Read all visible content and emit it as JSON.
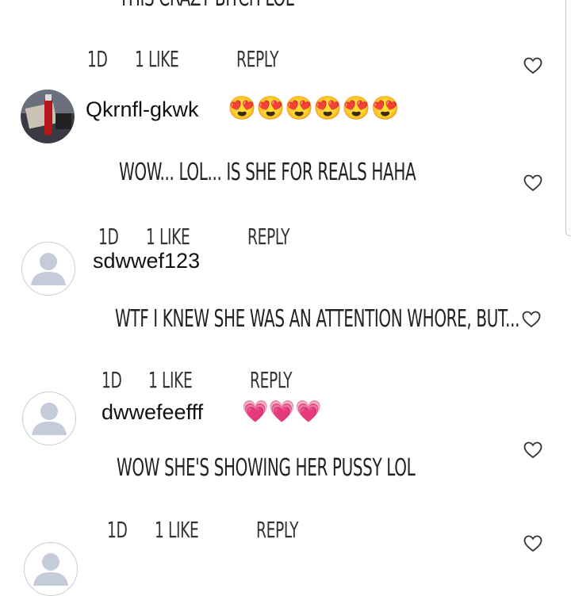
{
  "comments": [
    {
      "text": "THIS CRAZY BITCH LOL",
      "age": "1D",
      "likes": "1 LIKE",
      "reply": "REPLY"
    },
    {
      "username": "Qkrnfl-gkwk",
      "emoji": "😍😍😍😍😍😍",
      "text": "WOW... LOL... IS SHE FOR REALS HAHA",
      "age": "1D",
      "likes": "1 LIKE",
      "reply": "REPLY"
    },
    {
      "username": "sdwwef123",
      "text": "WTF I KNEW SHE WAS AN ATTENTION WHORE, BUT...",
      "age": "1D",
      "likes": "1 LIKE",
      "reply": "REPLY"
    },
    {
      "username": "dwwefeefff",
      "emoji": "💗💗💗",
      "text": "WOW SHE'S SHOWING HER PUSSY LOL",
      "age": "1D",
      "likes": "1 LIKE",
      "reply": "REPLY"
    }
  ],
  "icons": {
    "like": "heart-outline-icon",
    "avatar_default": "default-user-silhouette-icon"
  },
  "colors": {
    "avatar_placeholder": "#c6cbdc",
    "text": "#222222",
    "heart_stroke": "#333333"
  }
}
